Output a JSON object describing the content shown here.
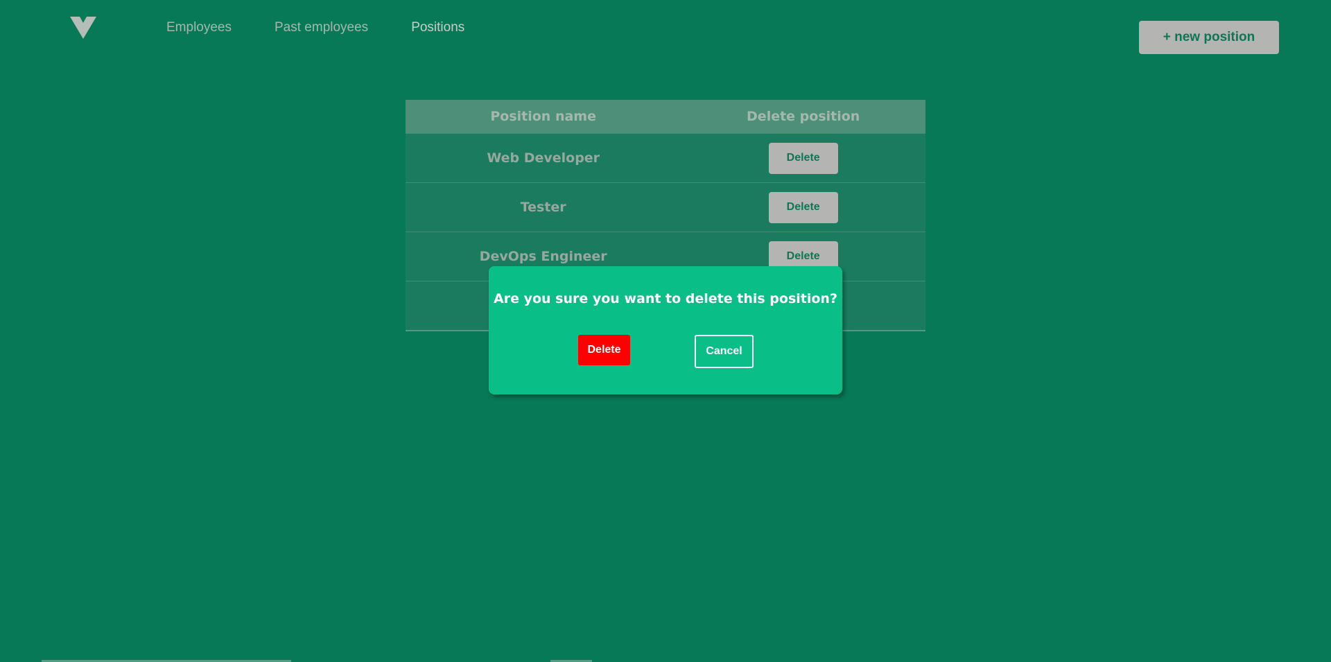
{
  "nav": {
    "items": [
      {
        "label": "Employees"
      },
      {
        "label": "Past employees"
      },
      {
        "label": "Positions"
      }
    ]
  },
  "header": {
    "new_button_label": "+ new position"
  },
  "table": {
    "columns": [
      "Position name",
      "Delete position"
    ],
    "rows": [
      {
        "name": "Web Developer",
        "action": "Delete"
      },
      {
        "name": "Tester",
        "action": "Delete"
      },
      {
        "name": "DevOps Engineer",
        "action": "Delete"
      },
      {
        "name": "",
        "action": ""
      }
    ]
  },
  "modal": {
    "message": "Are you sure you want to delete this position?",
    "confirm_label": "Delete",
    "cancel_label": "Cancel"
  },
  "colors": {
    "background": "#087957",
    "modal": "#0abf87",
    "danger": "#ff0000",
    "button_gray": "#b4b5b3"
  }
}
